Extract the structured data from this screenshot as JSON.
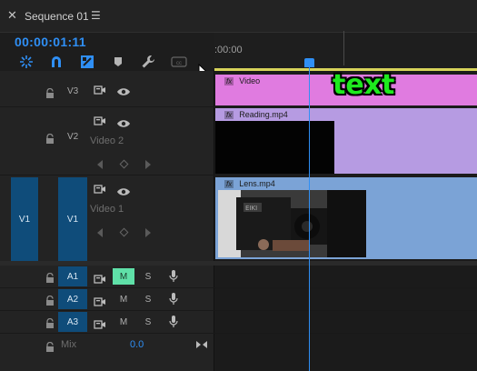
{
  "header": {
    "close_glyph": "✕",
    "title": "Sequence 01",
    "menu_glyph": "☰"
  },
  "timecode": "00:00:01:11",
  "ruler": {
    "start_label": ":00:00"
  },
  "tracks": {
    "v3": {
      "label": "V3"
    },
    "v2": {
      "label": "V2",
      "name": "Video 2"
    },
    "v1": {
      "source_label": "V1",
      "label": "V1",
      "name": "Video 1"
    },
    "a1": {
      "label": "A1",
      "mute": "M",
      "solo": "S"
    },
    "a2": {
      "label": "A2",
      "mute": "M",
      "solo": "S"
    },
    "a3": {
      "label": "A3",
      "mute": "M",
      "solo": "S"
    },
    "mix": {
      "label": "Mix",
      "value": "0.0"
    }
  },
  "clips": {
    "v3_clip": {
      "fx": "fx",
      "name": "Video",
      "color": "#e07be0"
    },
    "v2_clip": {
      "fx": "fx",
      "name": "Reading.mp4",
      "color": "#b69be2"
    },
    "v1_clip": {
      "fx": "fx",
      "name": "Lens.mp4",
      "color": "#7ba3d6"
    }
  },
  "overlay": {
    "text": "text"
  },
  "colors": {
    "accent": "#2f8ff5",
    "work_area": "#d6d35a",
    "mute_on": "#5fe0a8",
    "track_target": "#0f4c7a"
  },
  "icons": [
    "snap-icon",
    "linked-selection-icon",
    "add-marker-icon",
    "wrench-icon",
    "captions-icon",
    "lock-icon",
    "camera-icon",
    "eye-icon",
    "microphone-icon",
    "keyframe-icon"
  ]
}
